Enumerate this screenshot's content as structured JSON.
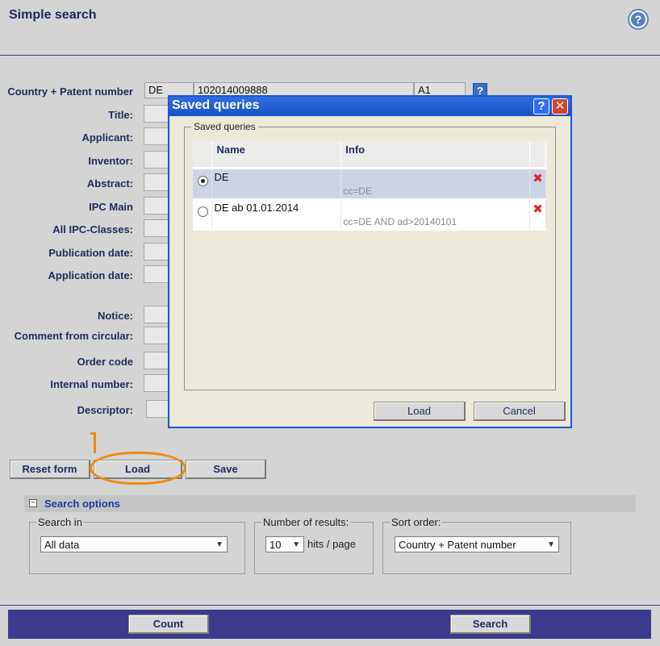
{
  "page": {
    "title": "Simple search",
    "help_icon": "question-circle-icon"
  },
  "form": {
    "country_pn": {
      "label": "Country + Patent number",
      "country": "DE",
      "number": "102014009888",
      "kind": "A1",
      "help": "?"
    },
    "fields": [
      {
        "label": "Title:"
      },
      {
        "label": "Applicant:"
      },
      {
        "label": "Inventor:"
      },
      {
        "label": "Abstract:"
      },
      {
        "label": "IPC Main"
      },
      {
        "label": "All IPC-Classes:"
      },
      {
        "label": "Publication date:"
      },
      {
        "label": "Application date:"
      },
      {
        "label": "Notice:"
      },
      {
        "label": "Comment from circular:"
      },
      {
        "label": "Order code"
      },
      {
        "label": "Internal number:"
      },
      {
        "label": "Descriptor:"
      }
    ]
  },
  "actions": {
    "reset_label": "Reset form",
    "load_label": "Load",
    "save_label": "Save"
  },
  "search_options": {
    "title": "Search options",
    "toggle": "−",
    "search_in": {
      "legend": "Search in",
      "value": "All data"
    },
    "num_results": {
      "legend": "Number of results:",
      "value": "10",
      "suffix": "hits / page"
    },
    "sort_order": {
      "legend": "Sort order:",
      "value": "Country + Patent number"
    }
  },
  "footer": {
    "count_label": "Count",
    "search_label": "Search"
  },
  "dialog": {
    "title": "Saved queries",
    "help": "?",
    "close": "✕",
    "group_legend": "Saved queries",
    "columns": [
      "Name",
      "Info"
    ],
    "rows": [
      {
        "name": "DE",
        "info": "cc=DE",
        "selected": true
      },
      {
        "name": "DE ab 01.01.2014",
        "info": "cc=DE AND ad>20140101",
        "selected": false
      }
    ],
    "delete_icon": "✖",
    "load_label": "Load",
    "cancel_label": "Cancel"
  },
  "colors": {
    "highlight": "#ee8a10",
    "footer_bar": "#3b3a8c",
    "dialog_title": "#1b57d6"
  }
}
